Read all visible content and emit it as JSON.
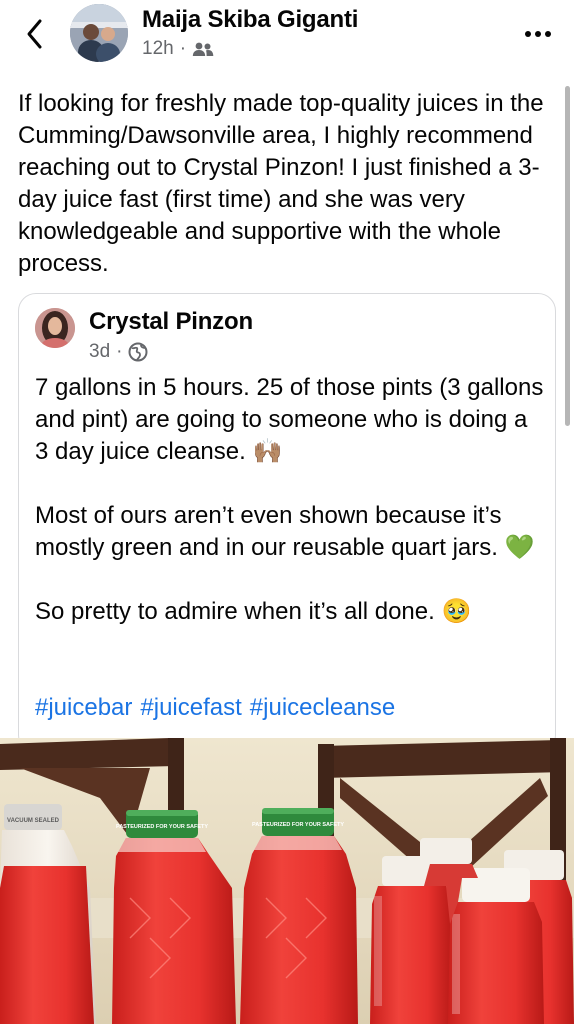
{
  "header": {
    "author": "Maija Skiba Giganti",
    "time": "12h",
    "separator": "·",
    "audience_icon": "friends-icon",
    "back_icon": "chevron-left-icon",
    "more_icon": "more-dots-icon"
  },
  "post": {
    "text": "If looking for freshly made top-quality juices in the Cumming/Dawsonville area, I highly recommend reaching out to Crystal Pinzon! I just finished a 3-day juice fast (first time) and she was very knowledgeable and supportive with the whole process."
  },
  "shared_post": {
    "author": "Crystal Pinzon",
    "time": "3d",
    "separator": "·",
    "audience_icon": "globe-icon",
    "paragraphs": [
      "7 gallons in 5 hours. 25 of those pints (3 gallons and pint) are going to someone who is doing a 3 day juice cleanse. 🙌🏽",
      "Most of ours aren’t even shown because it’s mostly green and in our reusable quart jars. 💚",
      "So pretty to admire when it’s all done. 🥹"
    ],
    "hashtags": [
      "#juicebar",
      "#juicefast",
      "#juicecleanse"
    ]
  },
  "photo": {
    "lid_text": "PASTEURIZED FOR YOUR SAFETY",
    "lid_text_left": "VACUUM SEALED"
  },
  "colors": {
    "link": "#1b74e4",
    "meta": "#65676b",
    "juice": "#e8322e",
    "lid_green": "#2f8a3c"
  }
}
